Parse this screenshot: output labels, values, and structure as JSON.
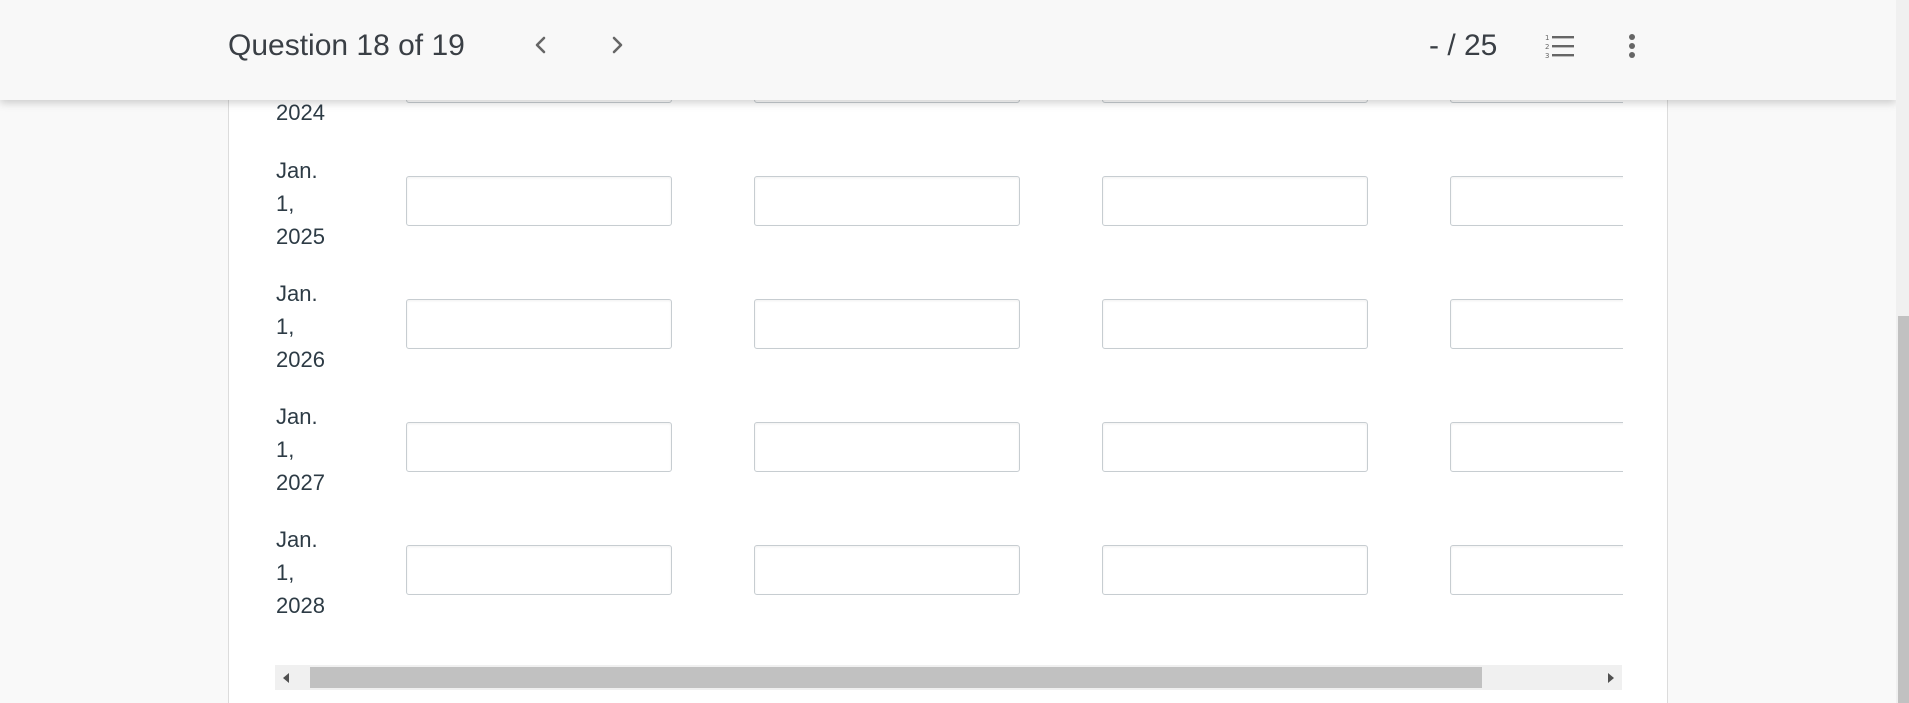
{
  "header": {
    "question_counter": "Question 18 of 19",
    "prev_icon": "chevron-left-icon",
    "next_icon": "chevron-right-icon",
    "score": "- / 25",
    "question_list_icon": "numbered-list-icon",
    "more_icon": "kebab-menu-icon"
  },
  "table": {
    "partial_top_row_label": "2024",
    "rows": [
      {
        "label": "Jan.\n1,\n2025",
        "values": [
          "",
          "",
          "",
          ""
        ]
      },
      {
        "label": "Jan.\n1,\n2026",
        "values": [
          "",
          "",
          "",
          ""
        ]
      },
      {
        "label": "Jan.\n1,\n2027",
        "values": [
          "",
          "",
          "",
          ""
        ]
      },
      {
        "label": "Jan.\n1,\n2028",
        "values": [
          "",
          "",
          "",
          ""
        ]
      }
    ]
  },
  "scrollbars": {
    "horizontal": {
      "visible_fraction": 0.91,
      "position": 0.0
    },
    "vertical": {
      "visible_fraction": 0.55,
      "position": 1.0
    }
  }
}
